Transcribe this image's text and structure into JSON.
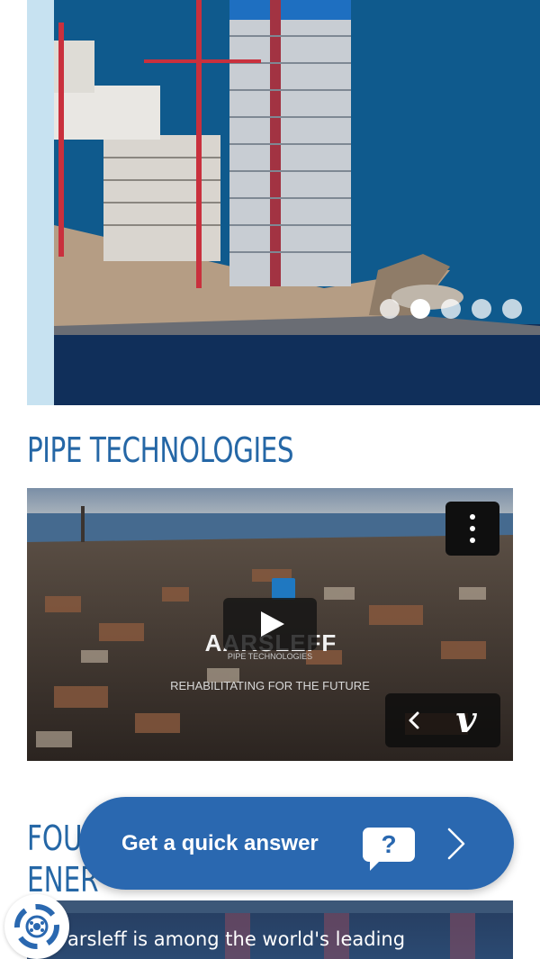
{
  "hero": {
    "slide_count": 5,
    "active_slide": 2,
    "image_alt": "Harbour high-rise tower under construction"
  },
  "section": {
    "title": "PIPE TECHNOLOGIES"
  },
  "video": {
    "logo_word": "AARSLEFF",
    "logo_sub": "PIPE TECHNOLOGIES",
    "tagline": "REHABILITATING FOR THE FUTURE",
    "provider": "vimeo"
  },
  "next_section": {
    "title_line1": "FOU",
    "title_line2": "ENER",
    "teaser_text": "arsleff is among the world's leading"
  },
  "chat": {
    "label": "Get a quick answer",
    "bubble_mark": "?"
  },
  "colors": {
    "brand_blue": "#2567a6",
    "chat_blue": "#2a68b0",
    "hero_sidebar": "#c7e2f1"
  }
}
